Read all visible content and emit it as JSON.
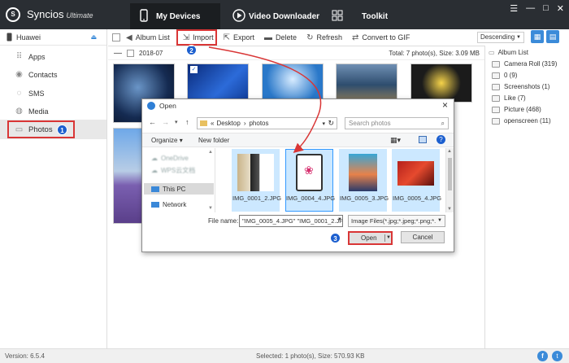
{
  "app": {
    "name": "Syncios",
    "edition": "Ultimate",
    "tabs": [
      {
        "label": "My Devices"
      },
      {
        "label": "Video Downloader"
      },
      {
        "label": "Toolkit"
      }
    ]
  },
  "device": {
    "name": "Huawei"
  },
  "sidebar": {
    "items": [
      {
        "label": "Apps"
      },
      {
        "label": "Contacts"
      },
      {
        "label": "SMS"
      },
      {
        "label": "Media"
      },
      {
        "label": "Photos"
      }
    ]
  },
  "toolbar": {
    "album_list": "Album List",
    "import": "Import",
    "export": "Export",
    "delete": "Delete",
    "refresh": "Refresh",
    "convert_gif": "Convert to GIF",
    "sort": "Descending"
  },
  "date_row": {
    "date": "2018-07",
    "total": "Total: 7 photo(s), Size: 3.09 MB"
  },
  "albums": {
    "title": "Album List",
    "items": [
      {
        "label": "Camera Roll (319)"
      },
      {
        "label": "0 (9)"
      },
      {
        "label": "Screenshots (1)"
      },
      {
        "label": "Like (7)"
      },
      {
        "label": "Picture (468)"
      },
      {
        "label": "openscreen (11)"
      }
    ]
  },
  "steps": [
    "1",
    "2",
    "3"
  ],
  "dialog": {
    "title": "Open",
    "path": [
      "Desktop",
      "photos"
    ],
    "search_placeholder": "Search photos",
    "organize": "Organize",
    "new_folder": "New folder",
    "nav": [
      {
        "label": "OneDrive"
      },
      {
        "label": "WPS云文档"
      },
      {
        "label": "This PC"
      },
      {
        "label": "Network"
      }
    ],
    "files": [
      {
        "name": "IMG_0001_2.JPG"
      },
      {
        "name": "IMG_0004_4.JPG"
      },
      {
        "name": "IMG_0005_3.JPG"
      },
      {
        "name": "IMG_0005_4.JPG"
      }
    ],
    "file_name_label": "File name:",
    "file_name_value": "\"IMG_0005_4.JPG\" \"IMG_0001_2.JP",
    "file_type": "Image Files(*.jpg;*.jpeg;*.png;*.",
    "open": "Open",
    "cancel": "Cancel"
  },
  "status": {
    "version": "Version: 6.5.4",
    "selection": "Selected: 1 photo(s), Size: 570.93 KB"
  }
}
